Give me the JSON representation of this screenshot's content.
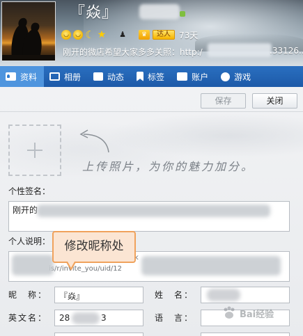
{
  "header": {
    "nickname": "『焱』",
    "days_text": "73天",
    "daren_label": "达人",
    "signature_start": "刚开的微店希望大家多多关照：http:/",
    "signature_end": ".33126..."
  },
  "tabs": [
    {
      "label": "资料",
      "icon": "profile-icon",
      "active": true
    },
    {
      "label": "相册",
      "icon": "album-icon"
    },
    {
      "label": "动态",
      "icon": "feed-icon"
    },
    {
      "label": "标签",
      "icon": "tag-icon"
    },
    {
      "label": "账户",
      "icon": "account-icon"
    },
    {
      "label": "游戏",
      "icon": "game-icon"
    }
  ],
  "toolbar": {
    "save_label": "保存",
    "close_label": "关闭"
  },
  "upload": {
    "hint": "上传照片，为你的魅力加分。"
  },
  "form": {
    "signature_label": "个性签名：",
    "signature_value": "刚开的",
    "description_label": "个人说明：",
    "description_line1": "h",
    "description_line1_end": "k",
    "description_line2": "is/r/invite_you/uid/12",
    "nickname_label": "昵　称：",
    "nickname_value": "『焱』",
    "name_label": "姓　名：",
    "name_value": "",
    "english_name_label": "英文名：",
    "english_name_value_start": "28",
    "english_name_value_end": "3",
    "language_label": "语　言："
  },
  "tooltip": {
    "text": "修改昵称处"
  },
  "watermark": {
    "text": "Bai经验"
  },
  "colors": {
    "tab_bar": "#1d5aa8",
    "tab_active": "#4f95de",
    "tooltip_border": "#f0a25c",
    "tooltip_fill": "#fbe5d3"
  }
}
